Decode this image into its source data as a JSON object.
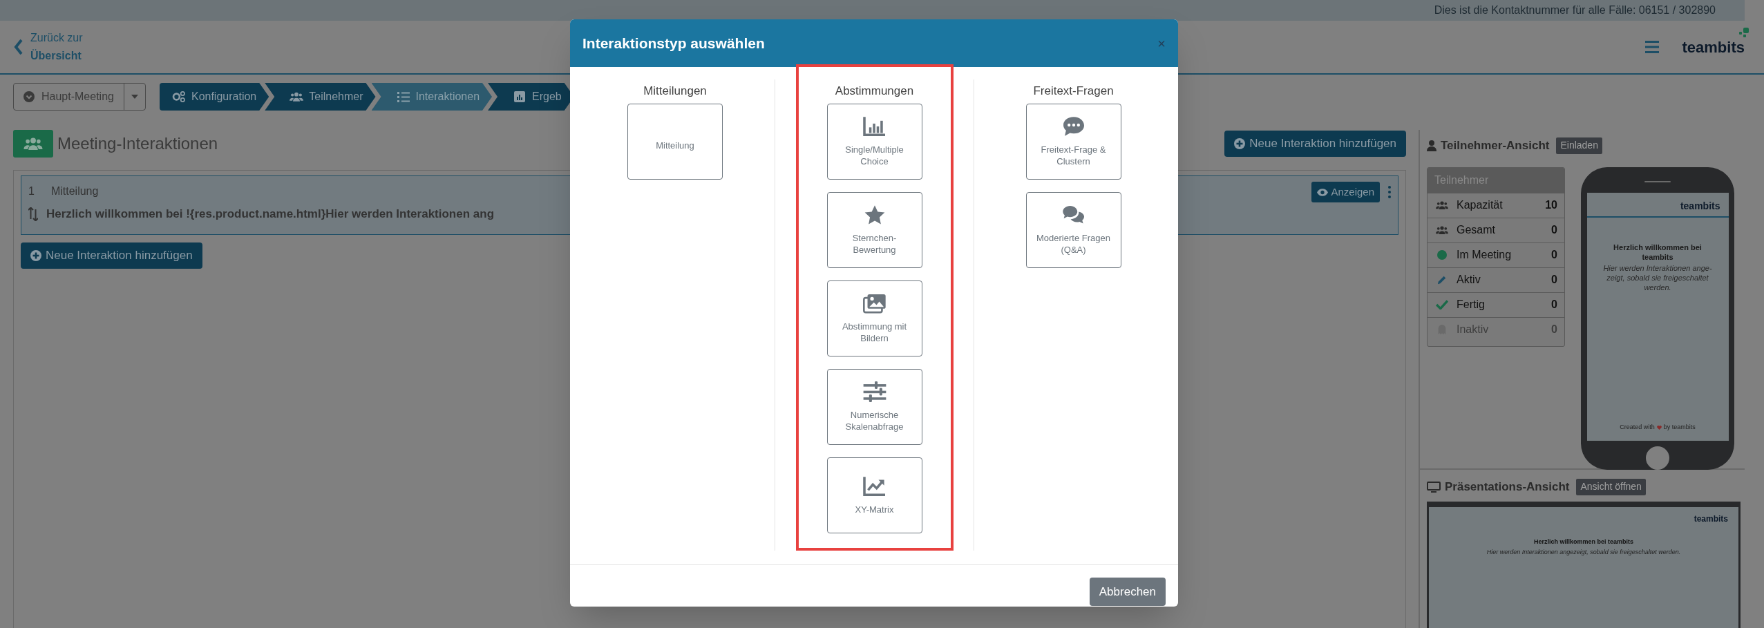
{
  "contact_bar": {
    "text": "Dies ist die Kontaktnummer für alle Fälle: 06151 / 302890"
  },
  "header": {
    "back_line1": "Zurück zur",
    "back_line2": "Übersicht",
    "logo": "teambits"
  },
  "toolbar": {
    "meeting_dropdown": "Haupt-Meeting",
    "steps": [
      {
        "kind": "config",
        "label": "Konfiguration",
        "selected": false
      },
      {
        "kind": "participants",
        "label": "Teilnehmer",
        "selected": false
      },
      {
        "kind": "interactions",
        "label": "Interaktionen",
        "selected": true
      },
      {
        "kind": "results",
        "label": "Ergeb",
        "selected": false
      }
    ]
  },
  "main": {
    "title": "Meeting-Interaktionen",
    "add_button": "Neue Interaktion hinzufügen",
    "interactions": [
      {
        "number": "1",
        "type": "Mitteilung",
        "text": "Herzlich willkommen bei !{res.product.name.html}Hier werden Interaktionen ang",
        "show_button": "Anzeigen"
      }
    ],
    "add_button_bottom": "Neue Interaktion hinzufügen"
  },
  "participant_view": {
    "title": "Teilnehmer-Ansicht",
    "invite_button": "Einladen",
    "stats": {
      "header": "Teilnehmer",
      "rows": [
        {
          "kind": "capacity",
          "label": "Kapazität",
          "value": "10",
          "muted": false
        },
        {
          "kind": "total",
          "label": "Gesamt",
          "value": "0",
          "muted": false
        },
        {
          "kind": "in_meeting",
          "label": "Im Meeting",
          "value": "0",
          "muted": false
        },
        {
          "kind": "active",
          "label": "Aktiv",
          "value": "0",
          "muted": false
        },
        {
          "kind": "done",
          "label": "Fertig",
          "value": "0",
          "muted": false
        },
        {
          "kind": "inactive",
          "label": "Inaktiv",
          "value": "0",
          "muted": true
        }
      ]
    },
    "phone": {
      "logo": "teambits",
      "heading": "Herzlich willkommen bei teambits",
      "text": "Hier werden Interaktionen ange-zeigt, sobald sie freigeschaltet werden.",
      "footer_left": "Created with",
      "footer_right": "by teambits"
    }
  },
  "presentation_view": {
    "title": "Präsentations-Ansicht",
    "open_button": "Ansicht öffnen",
    "screen": {
      "logo": "teambits",
      "heading": "Herzlich willkommen bei teambits",
      "text": "Hier werden Interaktionen angezeigt, sobald sie freigeschaltet werden."
    }
  },
  "dialog": {
    "title": "Interaktionstyp auswählen",
    "close": "×",
    "columns": [
      {
        "heading": "Mitteilungen",
        "highlighted": false,
        "tiles": [
          {
            "kind": "message",
            "label": "Mitteilung"
          }
        ]
      },
      {
        "heading": "Abstimmungen",
        "highlighted": true,
        "tiles": [
          {
            "kind": "choice",
            "label": "Single/Multiple Choice"
          },
          {
            "kind": "stars",
            "label": "Sternchen-Bewertung"
          },
          {
            "kind": "images",
            "label": "Abstimmung mit Bildern"
          },
          {
            "kind": "scale",
            "label": "Numerische Skalenabfrage"
          },
          {
            "kind": "matrix",
            "label": "XY-Matrix"
          }
        ]
      },
      {
        "heading": "Freitext-Fragen",
        "highlighted": false,
        "tiles": [
          {
            "kind": "freetext",
            "label": "Freitext-Frage & Clustern"
          },
          {
            "kind": "qa",
            "label": "Moderierte Fragen (Q&A)"
          }
        ]
      }
    ],
    "cancel_button": "Abbrechen"
  }
}
